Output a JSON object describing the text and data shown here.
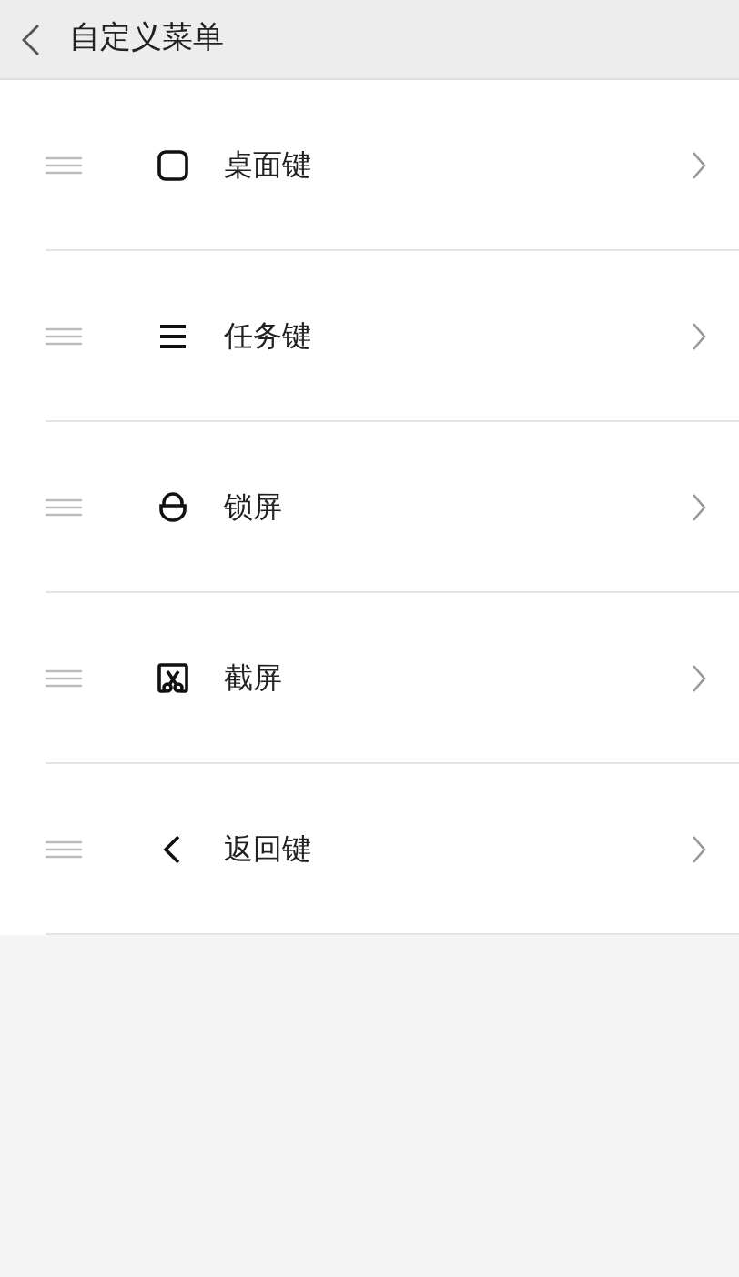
{
  "header": {
    "title": "自定义菜单"
  },
  "items": [
    {
      "kind": "home",
      "label": "桌面键"
    },
    {
      "kind": "tasks",
      "label": "任务键"
    },
    {
      "kind": "lock",
      "label": "锁屏"
    },
    {
      "kind": "screenshot",
      "label": "截屏"
    },
    {
      "kind": "back",
      "label": "返回键"
    }
  ]
}
